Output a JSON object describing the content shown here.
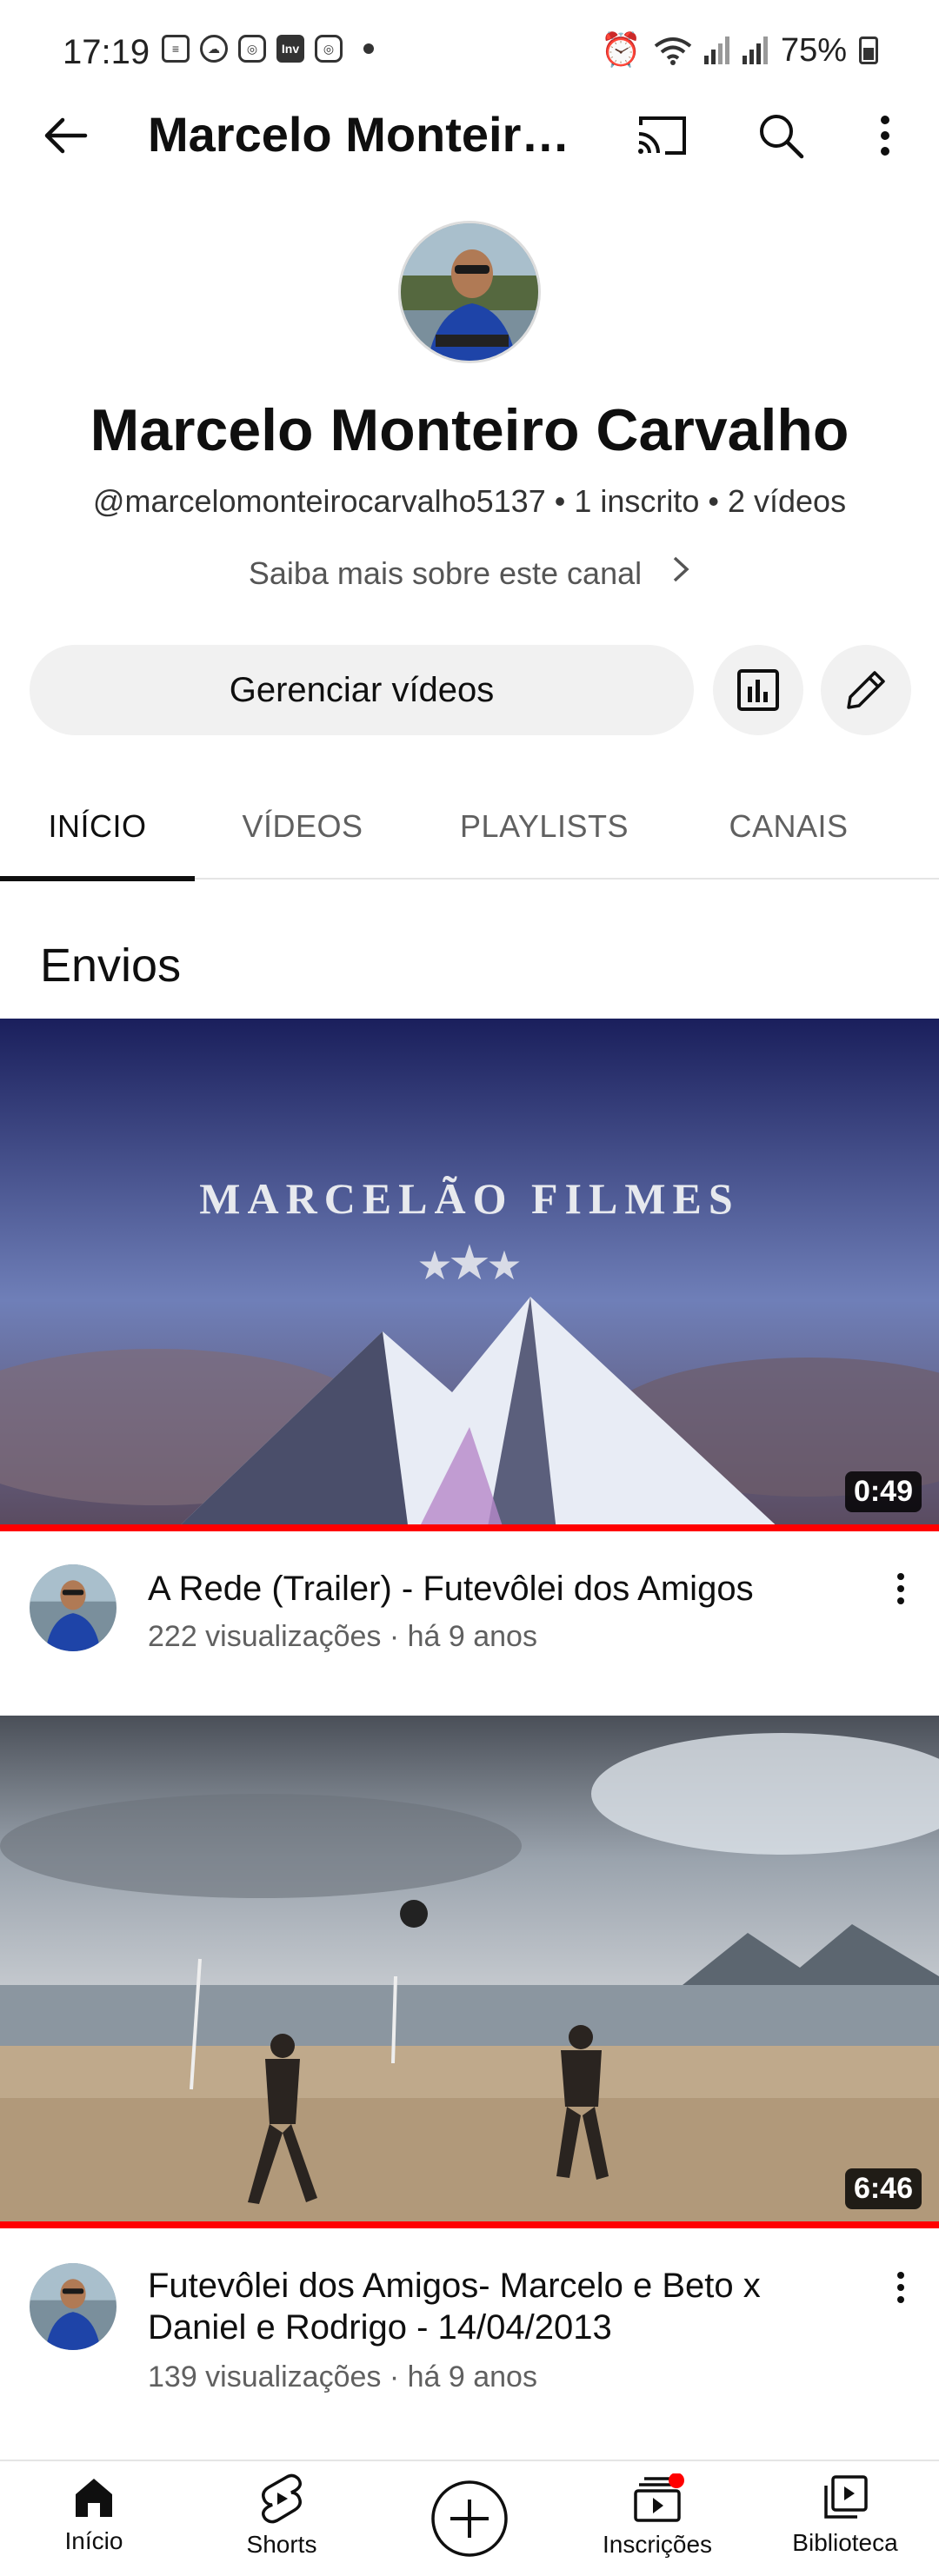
{
  "status_bar": {
    "time": "17:19",
    "battery": "75%",
    "icons": [
      "message-icon",
      "weather-icon",
      "instagram-icon",
      "investing-icon",
      "instagram-icon",
      "dot-icon",
      "alarm-icon",
      "wifi-icon",
      "signal-icon",
      "signal-icon",
      "battery-icon"
    ]
  },
  "app_bar": {
    "title": "Marcelo Monteiro Carvalho",
    "actions": [
      "cast-icon",
      "search-icon",
      "more-vert-icon"
    ]
  },
  "channel": {
    "name": "Marcelo Monteiro Carvalho",
    "meta": "@marcelomonteirocarvalho5137 • 1 inscrito • 2 vídeos",
    "about": "Saiba mais sobre este canal",
    "manage_label": "Gerenciar vídeos"
  },
  "tabs": [
    {
      "label": "INÍCIO",
      "active": true
    },
    {
      "label": "VÍDEOS",
      "active": false
    },
    {
      "label": "PLAYLISTS",
      "active": false
    },
    {
      "label": "CANAIS",
      "active": false
    }
  ],
  "section_title": "Envios",
  "videos": [
    {
      "title": "A Rede (Trailer) - Futevôlei dos Amigos",
      "meta": "222 visualizações · há 9 anos",
      "duration": "0:49",
      "thumbnail_text": "MARCELÃO FILMES"
    },
    {
      "title": "Futevôlei dos Amigos- Marcelo e Beto x Daniel e Rodrigo - 14/04/2013",
      "meta": "139 visualizações · há 9 anos",
      "duration": "6:46"
    }
  ],
  "bottom_nav": [
    {
      "label": "Início",
      "icon": "home-icon"
    },
    {
      "label": "Shorts",
      "icon": "shorts-icon"
    },
    {
      "label": "",
      "icon": "create-icon"
    },
    {
      "label": "Inscrições",
      "icon": "subscriptions-icon"
    },
    {
      "label": "Biblioteca",
      "icon": "library-icon"
    }
  ],
  "colors": {
    "accent_red": "#ff0000",
    "chip_bg": "#f1f1f1",
    "text_primary": "#0f0f0f",
    "text_secondary": "#606060"
  }
}
